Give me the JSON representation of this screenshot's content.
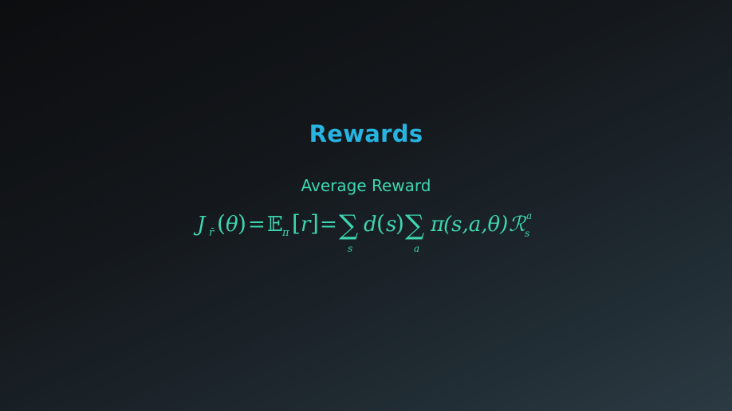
{
  "slide": {
    "title": "Rewards",
    "subtitle": "Average Reward"
  },
  "equation": {
    "J": "J",
    "J_sub": "r̄",
    "theta_paren_open": "(",
    "theta": "θ",
    "theta_paren_close": ")",
    "eq1": "=",
    "E": "𝔼",
    "E_sub": "π",
    "bracket_open": "[",
    "r": "r",
    "bracket_close": "]",
    "eq2": "=",
    "sum1": "∑",
    "sum1_sub": "s",
    "d": "d",
    "d_paren_open": "(",
    "d_arg": "s",
    "d_paren_close": ")",
    "sum2": "∑",
    "sum2_sub": "a",
    "pi": "π",
    "pi_args": "(s,a,θ)",
    "R": "ℛ",
    "R_sup": "a",
    "R_sub": "s"
  },
  "colors": {
    "title": "#27b4e0",
    "text": "#3dd5b0"
  }
}
